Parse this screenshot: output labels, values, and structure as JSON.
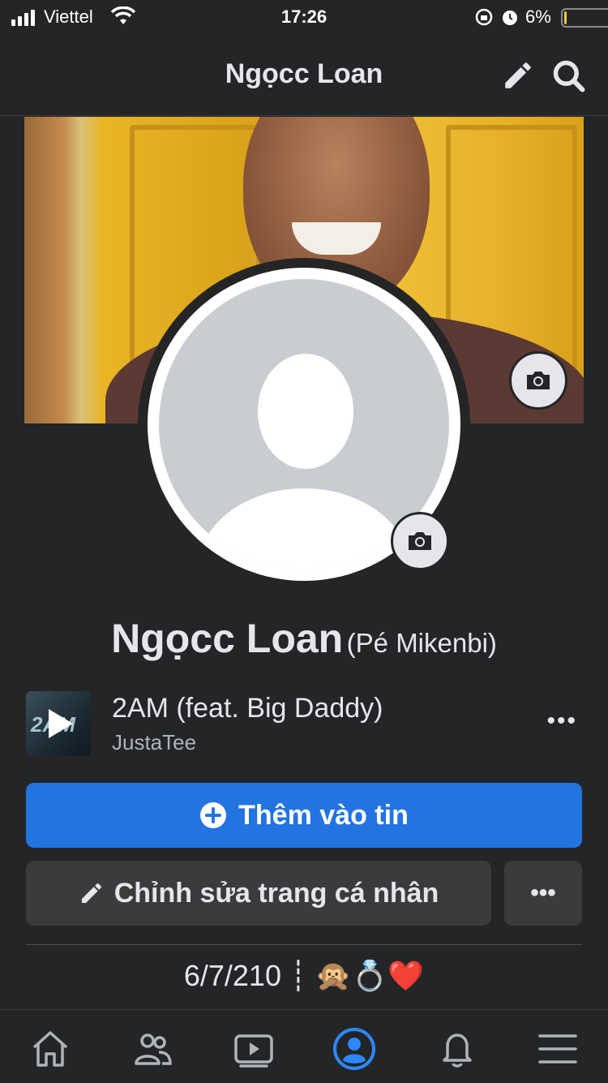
{
  "status_bar": {
    "carrier": "Viettel",
    "time": "17:26",
    "battery_pct": "6%",
    "icons": [
      "signal-icon",
      "wifi-icon",
      "orientation-lock-icon",
      "alarm-icon",
      "battery-icon"
    ],
    "battery_level": 0.06
  },
  "header": {
    "title": "Ngọcc Loan",
    "icons": [
      "edit-pencil-icon",
      "search-icon"
    ]
  },
  "profile": {
    "name": "Ngọcc Loan",
    "alternate_name": "(Pé Mikenbi)",
    "cover_camera_icon": "camera-icon",
    "avatar_camera_icon": "camera-icon"
  },
  "music": {
    "title": "2AM (feat. Big Daddy)",
    "artist": "JustaTee",
    "album_text": "2AM",
    "more": "•••"
  },
  "actions": {
    "add_story_label": "Thêm vào tin",
    "edit_profile_label": "Chỉnh sửa trang cá nhân",
    "more_label": "•••"
  },
  "bio": "6/7/210 ┊ 🙊💍❤️",
  "tabbar": {
    "tabs": [
      "home-icon",
      "friends-icon",
      "watch-icon",
      "profile-icon",
      "notifications-icon",
      "menu-icon"
    ],
    "active": "profile-icon"
  },
  "colors": {
    "background": "#242526",
    "primary_blue": "#2374e1",
    "active_tab": "#2d88ff",
    "secondary_button": "#3a3b3c"
  }
}
